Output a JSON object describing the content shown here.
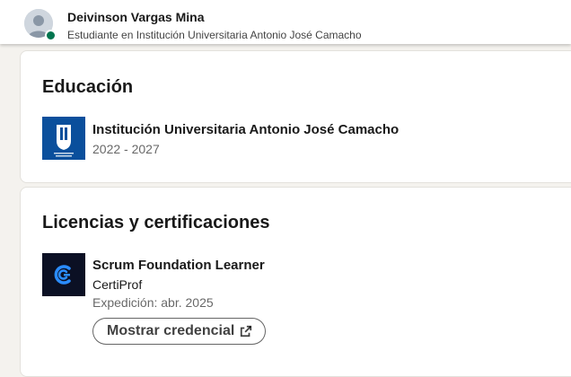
{
  "header": {
    "name": "Deivinson Vargas Mina",
    "headline": "Estudiante en Institución Universitaria Antonio José Camacho",
    "presence_color": "#01754f"
  },
  "education": {
    "title": "Educación",
    "items": [
      {
        "school": "Institución Universitaria Antonio José Camacho",
        "dates": "2022 - 2027",
        "logo_icon": "university-logo-icon",
        "logo_color": "#0a4f9c"
      }
    ]
  },
  "licenses": {
    "title": "Licencias y certificaciones",
    "items": [
      {
        "name": "Scrum Foundation Learner",
        "issuer": "CertiProf",
        "issued": "Expedición: abr. 2025",
        "logo_icon": "certiprof-logo-icon",
        "button_label": "Mostrar credencial",
        "button_icon": "external-link-icon"
      }
    ]
  }
}
